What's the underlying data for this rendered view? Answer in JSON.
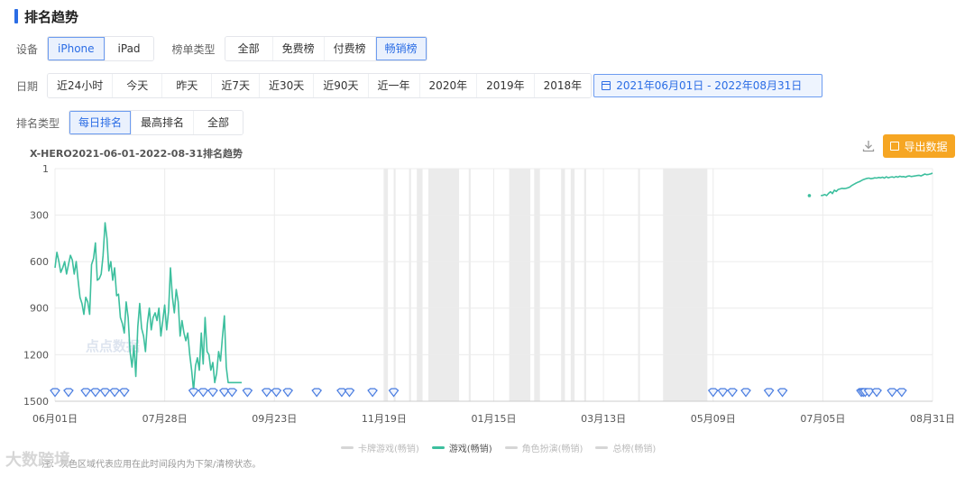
{
  "section_title": "排名趋势",
  "device": {
    "label": "设备",
    "options": [
      "iPhone",
      "iPad"
    ],
    "selected": 0
  },
  "list_type": {
    "label": "榜单类型",
    "options": [
      "全部",
      "免费榜",
      "付费榜",
      "畅销榜"
    ],
    "selected": 3
  },
  "date": {
    "label": "日期",
    "options": [
      "近24小时",
      "今天",
      "昨天",
      "近7天",
      "近30天",
      "近90天",
      "近一年",
      "2020年",
      "2019年",
      "2018年"
    ],
    "range": "2021年06月01日 - 2022年08月31日"
  },
  "rank_type": {
    "label": "排名类型",
    "options": [
      "每日排名",
      "最高排名",
      "全部"
    ],
    "selected": 0
  },
  "export_label": "导出数据",
  "watermark": "点点数据",
  "corner_watermark": "大数跨境",
  "footnote": "注：灰色区域代表应用在此时间段内为下架/清榜状态。",
  "colors": {
    "accent": "#2b6de5",
    "series": "#3dbf9e",
    "export": "#f6a623",
    "offline": "#ebebeb",
    "marker": "#4a7de0"
  },
  "chart_data": {
    "type": "line",
    "title": "X-HERO2021-06-01-2022-08-31排名趋势",
    "y_inverted": true,
    "ylim": [
      1,
      1500
    ],
    "yticks": [
      1,
      300,
      600,
      900,
      1200,
      1500
    ],
    "xlim": [
      "2021-06-01",
      "2022-08-31"
    ],
    "xticks": [
      "06月01日",
      "07月28日",
      "09月23日",
      "11月19日",
      "01月15日",
      "03月13日",
      "05月09日",
      "07月05日",
      "08月31日"
    ],
    "xtick_dates": [
      "2021-06-01",
      "2021-07-28",
      "2021-09-23",
      "2021-11-19",
      "2022-01-15",
      "2022-03-13",
      "2022-05-09",
      "2022-07-05",
      "2022-08-31"
    ],
    "grid": true,
    "legend": [
      "卡牌游戏(畅销)",
      "游戏(畅销)",
      "角色扮演(畅销)",
      "总榜(畅销)"
    ],
    "legend_position": "bottom",
    "series": [
      {
        "name": "游戏(畅销)",
        "points": [
          [
            "2021-06-01",
            640
          ],
          [
            "2021-06-02",
            540
          ],
          [
            "2021-06-03",
            600
          ],
          [
            "2021-06-04",
            670
          ],
          [
            "2021-06-05",
            640
          ],
          [
            "2021-06-06",
            600
          ],
          [
            "2021-06-07",
            680
          ],
          [
            "2021-06-08",
            620
          ],
          [
            "2021-06-09",
            560
          ],
          [
            "2021-06-10",
            590
          ],
          [
            "2021-06-11",
            680
          ],
          [
            "2021-06-12",
            600
          ],
          [
            "2021-06-13",
            720
          ],
          [
            "2021-06-14",
            830
          ],
          [
            "2021-06-15",
            870
          ],
          [
            "2021-06-16",
            940
          ],
          [
            "2021-06-17",
            830
          ],
          [
            "2021-06-18",
            860
          ],
          [
            "2021-06-19",
            940
          ],
          [
            "2021-06-20",
            620
          ],
          [
            "2021-06-21",
            580
          ],
          [
            "2021-06-22",
            480
          ],
          [
            "2021-06-23",
            720
          ],
          [
            "2021-06-24",
            710
          ],
          [
            "2021-06-25",
            680
          ],
          [
            "2021-06-26",
            560
          ],
          [
            "2021-06-27",
            350
          ],
          [
            "2021-06-28",
            450
          ],
          [
            "2021-06-29",
            660
          ],
          [
            "2021-06-30",
            600
          ],
          [
            "2021-07-01",
            720
          ],
          [
            "2021-07-02",
            640
          ],
          [
            "2021-07-03",
            820
          ],
          [
            "2021-07-04",
            810
          ],
          [
            "2021-07-05",
            960
          ],
          [
            "2021-07-06",
            1000
          ],
          [
            "2021-07-07",
            1060
          ],
          [
            "2021-07-08",
            860
          ],
          [
            "2021-07-09",
            960
          ],
          [
            "2021-07-10",
            1180
          ],
          [
            "2021-07-11",
            1280
          ],
          [
            "2021-07-12",
            1140
          ],
          [
            "2021-07-13",
            1340
          ],
          [
            "2021-07-14",
            1020
          ],
          [
            "2021-07-15",
            870
          ],
          [
            "2021-07-16",
            1030
          ],
          [
            "2021-07-17",
            1080
          ],
          [
            "2021-07-18",
            1180
          ],
          [
            "2021-07-19",
            1000
          ],
          [
            "2021-07-20",
            900
          ],
          [
            "2021-07-21",
            1040
          ],
          [
            "2021-07-22",
            960
          ],
          [
            "2021-07-23",
            930
          ],
          [
            "2021-07-24",
            980
          ],
          [
            "2021-07-25",
            900
          ],
          [
            "2021-07-26",
            1080
          ],
          [
            "2021-07-27",
            980
          ],
          [
            "2021-07-28",
            880
          ],
          [
            "2021-07-29",
            1040
          ],
          [
            "2021-07-30",
            920
          ],
          [
            "2021-07-31",
            640
          ],
          [
            "2021-08-01",
            830
          ],
          [
            "2021-08-02",
            930
          ],
          [
            "2021-08-03",
            780
          ],
          [
            "2021-08-04",
            860
          ],
          [
            "2021-08-05",
            1080
          ],
          [
            "2021-08-06",
            980
          ],
          [
            "2021-08-07",
            1060
          ],
          [
            "2021-08-08",
            1110
          ],
          [
            "2021-08-09",
            1060
          ],
          [
            "2021-08-10",
            1200
          ],
          [
            "2021-08-11",
            1300
          ],
          [
            "2021-08-12",
            1430
          ],
          [
            "2021-08-13",
            1270
          ],
          [
            "2021-08-14",
            1220
          ],
          [
            "2021-08-15",
            1300
          ],
          [
            "2021-08-16",
            1060
          ],
          [
            "2021-08-17",
            1260
          ],
          [
            "2021-08-18",
            960
          ],
          [
            "2021-08-19",
            1180
          ],
          [
            "2021-08-20",
            1200
          ],
          [
            "2021-08-21",
            1300
          ],
          [
            "2021-08-22",
            1250
          ],
          [
            "2021-08-23",
            1380
          ],
          [
            "2021-08-24",
            1320
          ],
          [
            "2021-08-25",
            1180
          ],
          [
            "2021-08-26",
            1240
          ],
          [
            "2021-08-27",
            1090
          ],
          [
            "2021-08-28",
            950
          ],
          [
            "2021-08-29",
            1280
          ],
          [
            "2021-08-30",
            1380
          ],
          [
            "2021-09-02",
            1380
          ],
          [
            "2021-09-06",
            1380
          ]
        ]
      },
      {
        "name": "游戏(畅销)",
        "points": [
          [
            "2022-07-04",
            175
          ],
          [
            "2022-07-05",
            173
          ],
          [
            "2022-07-06",
            168
          ],
          [
            "2022-07-07",
            175
          ],
          [
            "2022-07-08",
            160
          ],
          [
            "2022-07-09",
            150
          ],
          [
            "2022-07-10",
            162
          ],
          [
            "2022-07-11",
            140
          ],
          [
            "2022-07-12",
            148
          ],
          [
            "2022-07-13",
            135
          ],
          [
            "2022-07-14",
            132
          ],
          [
            "2022-07-15",
            128
          ],
          [
            "2022-07-16",
            130
          ],
          [
            "2022-07-17",
            128
          ],
          [
            "2022-07-18",
            125
          ],
          [
            "2022-07-19",
            120
          ],
          [
            "2022-07-20",
            110
          ],
          [
            "2022-07-21",
            103
          ],
          [
            "2022-07-22",
            96
          ],
          [
            "2022-07-23",
            90
          ],
          [
            "2022-07-24",
            85
          ],
          [
            "2022-07-25",
            78
          ],
          [
            "2022-07-26",
            72
          ],
          [
            "2022-07-27",
            68
          ],
          [
            "2022-07-28",
            64
          ],
          [
            "2022-07-29",
            62
          ],
          [
            "2022-07-30",
            66
          ],
          [
            "2022-07-31",
            64
          ],
          [
            "2022-08-01",
            60
          ],
          [
            "2022-08-02",
            62
          ],
          [
            "2022-08-03",
            58
          ],
          [
            "2022-08-04",
            60
          ],
          [
            "2022-08-05",
            56
          ],
          [
            "2022-08-06",
            62
          ],
          [
            "2022-08-07",
            54
          ],
          [
            "2022-08-08",
            60
          ],
          [
            "2022-08-09",
            56
          ],
          [
            "2022-08-10",
            54
          ],
          [
            "2022-08-11",
            58
          ],
          [
            "2022-08-12",
            52
          ],
          [
            "2022-08-13",
            56
          ],
          [
            "2022-08-14",
            50
          ],
          [
            "2022-08-15",
            54
          ],
          [
            "2022-08-16",
            52
          ],
          [
            "2022-08-17",
            56
          ],
          [
            "2022-08-18",
            50
          ],
          [
            "2022-08-19",
            48
          ],
          [
            "2022-08-20",
            52
          ],
          [
            "2022-08-21",
            50
          ],
          [
            "2022-08-22",
            48
          ],
          [
            "2022-08-23",
            46
          ],
          [
            "2022-08-24",
            44
          ],
          [
            "2022-08-25",
            48
          ],
          [
            "2022-08-26",
            42
          ],
          [
            "2022-08-27",
            36
          ],
          [
            "2022-08-28",
            40
          ],
          [
            "2022-08-29",
            38
          ],
          [
            "2022-08-30",
            35
          ],
          [
            "2022-08-31",
            30
          ]
        ]
      }
    ],
    "isolated_points": [
      [
        "2022-06-28",
        175
      ]
    ],
    "offline_periods": [
      [
        "2021-11-19",
        "2021-11-21"
      ],
      [
        "2021-11-24",
        "2021-11-25"
      ],
      [
        "2021-12-02",
        "2021-12-03"
      ],
      [
        "2021-12-06",
        "2021-12-09"
      ],
      [
        "2021-12-12",
        "2021-12-28"
      ],
      [
        "2022-01-02",
        "2022-01-03"
      ],
      [
        "2022-01-23",
        "2022-02-03"
      ],
      [
        "2022-02-05",
        "2022-02-08"
      ],
      [
        "2022-02-19",
        "2022-02-21"
      ],
      [
        "2022-02-24",
        "2022-02-26"
      ],
      [
        "2022-03-03",
        "2022-03-04"
      ],
      [
        "2022-03-31",
        "2022-04-01"
      ],
      [
        "2022-04-13",
        "2022-05-06"
      ]
    ],
    "event_markers": [
      "2021-06-01",
      "2021-06-08",
      "2021-06-17",
      "2021-06-22",
      "2021-06-27",
      "2021-07-02",
      "2021-07-07",
      "2021-08-12",
      "2021-08-17",
      "2021-08-22",
      "2021-08-28",
      "2021-09-01",
      "2021-09-09",
      "2021-09-19",
      "2021-09-24",
      "2021-09-30",
      "2021-10-15",
      "2021-10-28",
      "2021-11-01",
      "2021-11-13",
      "2021-11-24",
      "2022-05-09",
      "2022-05-14",
      "2022-05-19",
      "2022-05-26",
      "2022-06-07",
      "2022-06-14",
      "2022-07-25",
      "2022-07-26",
      "2022-07-27",
      "2022-07-29",
      "2022-08-02",
      "2022-08-10",
      "2022-08-15"
    ]
  }
}
